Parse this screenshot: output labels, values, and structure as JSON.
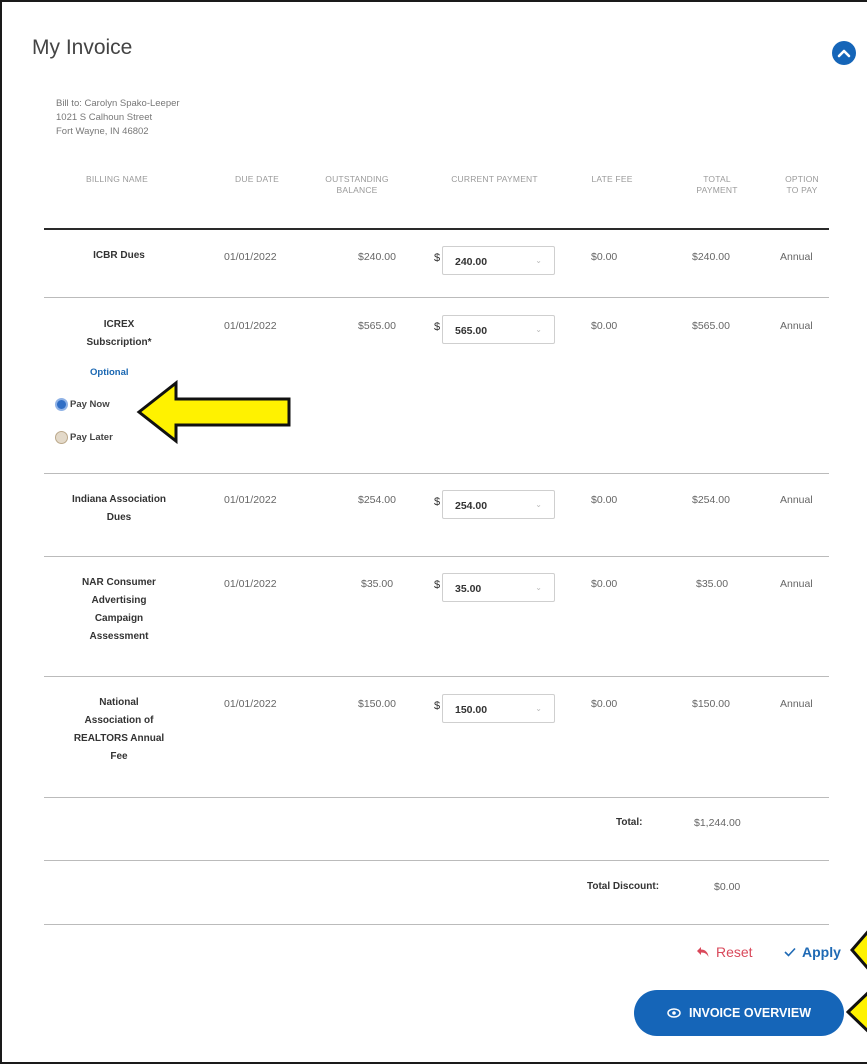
{
  "invoice": {
    "title": "My Invoice",
    "bill_to": [
      "Bill to: Carolyn Spako-Leeper",
      "1021 S Calhoun Street",
      "Fort Wayne, IN 46802"
    ]
  },
  "columns": {
    "billing_name": "BILLING NAME",
    "due_date": "DUE DATE",
    "outstanding_balance": [
      "OUTSTANDING",
      "BALANCE"
    ],
    "current_payment": "CURRENT PAYMENT",
    "late_fee": "LATE FEE",
    "total_payment": [
      "TOTAL",
      "PAYMENT"
    ],
    "option_to_pay": [
      "OPTION",
      "TO PAY"
    ]
  },
  "rows": [
    {
      "name": [
        "ICBR Dues"
      ],
      "due": "01/01/2022",
      "balance": "$240.00",
      "currency": "$",
      "payment": "240.00",
      "late_fee": "$0.00",
      "total": "$240.00",
      "option": "Annual"
    },
    {
      "name": [
        "ICREX",
        "Subscription*"
      ],
      "due": "01/01/2022",
      "balance": "$565.00",
      "currency": "$",
      "payment": "565.00",
      "late_fee": "$0.00",
      "total": "$565.00",
      "option": "Annual"
    },
    {
      "name": [
        "Indiana Association",
        "Dues"
      ],
      "due": "01/01/2022",
      "balance": "$254.00",
      "currency": "$",
      "payment": "254.00",
      "late_fee": "$0.00",
      "total": "$254.00",
      "option": "Annual"
    },
    {
      "name": [
        "NAR Consumer",
        "Advertising",
        "Campaign",
        "Assessment"
      ],
      "due": "01/01/2022",
      "balance": "$35.00",
      "currency": "$",
      "payment": "35.00",
      "late_fee": "$0.00",
      "total": "$35.00",
      "option": "Annual"
    },
    {
      "name": [
        "National",
        "Association of",
        "REALTORS Annual",
        "Fee"
      ],
      "due": "01/01/2022",
      "balance": "$150.00",
      "currency": "$",
      "payment": "150.00",
      "late_fee": "$0.00",
      "total": "$150.00",
      "option": "Annual"
    }
  ],
  "optional_block": {
    "label": "Optional",
    "pay_now": "Pay Now",
    "pay_later": "Pay Later",
    "selected": "pay_now"
  },
  "totals": {
    "total_label": "Total:",
    "total_value": "$1,244.00",
    "discount_label": "Total Discount:",
    "discount_value": "$0.00"
  },
  "actions": {
    "reset": "Reset",
    "apply": "Apply",
    "overview": "INVOICE OVERVIEW"
  },
  "colors": {
    "primary": "#1565b8",
    "reset": "#d9495b",
    "arrow_fill": "#fff200"
  }
}
